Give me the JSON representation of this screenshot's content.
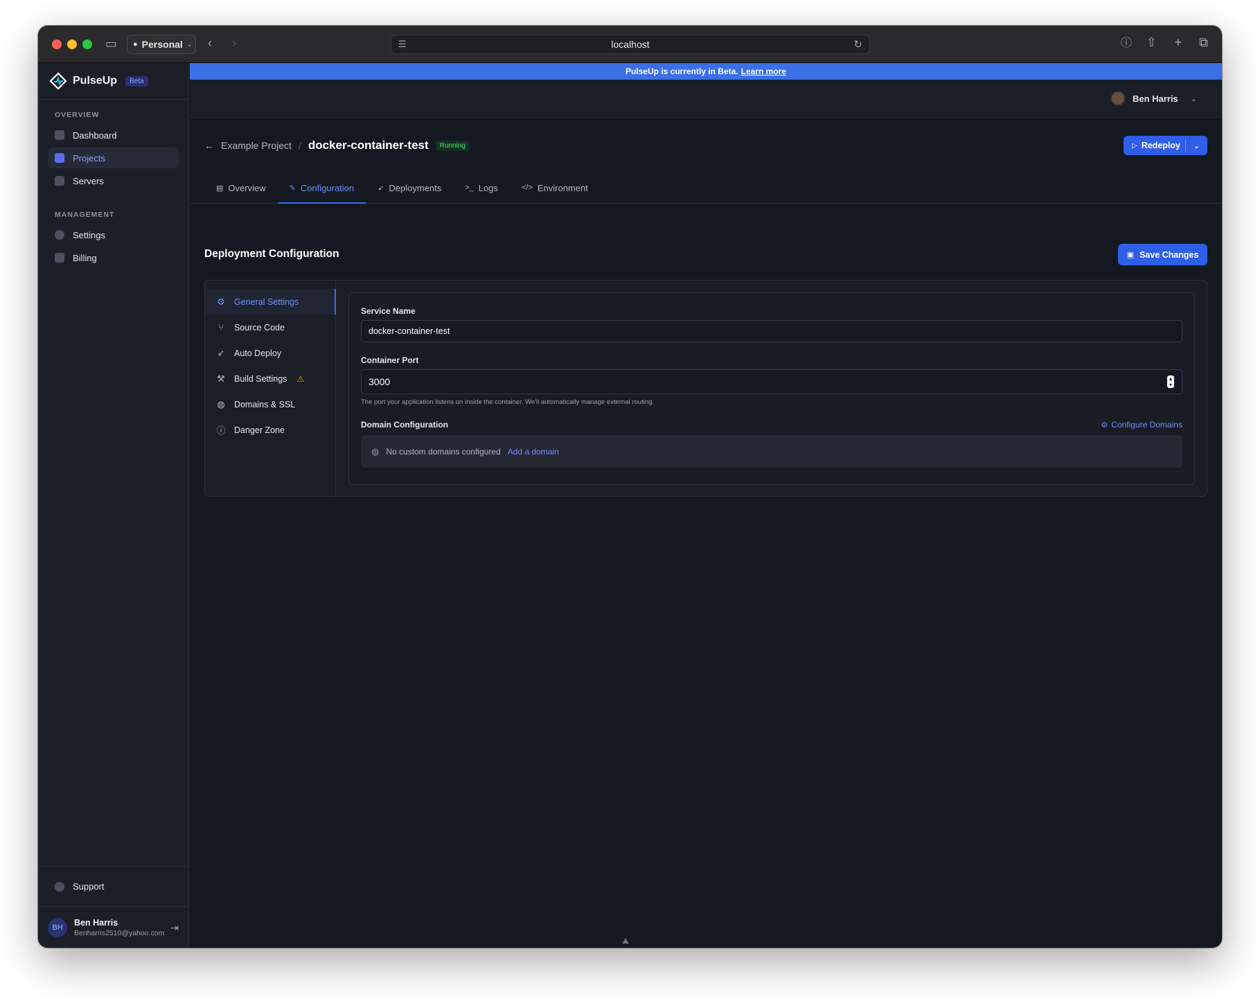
{
  "browser": {
    "profile_label": "Personal",
    "url": "localhost"
  },
  "sidebar": {
    "brand_name": "PulseUp",
    "brand_badge": "Beta",
    "sections": [
      {
        "label": "OVERVIEW",
        "items": [
          {
            "label": "Dashboard",
            "icon": "dashboard-icon",
            "active": false
          },
          {
            "label": "Projects",
            "icon": "folder-icon",
            "active": true
          },
          {
            "label": "Servers",
            "icon": "server-icon",
            "active": false
          }
        ]
      },
      {
        "label": "MANAGEMENT",
        "items": [
          {
            "label": "Settings",
            "icon": "gear-icon",
            "active": false
          },
          {
            "label": "Billing",
            "icon": "credit-card-icon",
            "active": false
          }
        ]
      }
    ],
    "support_label": "Support",
    "user": {
      "initials": "BH",
      "name": "Ben Harris",
      "email": "Benharris2510@yahoo.com"
    }
  },
  "banner": {
    "text": "PulseUp is currently in Beta.",
    "link_label": "Learn more"
  },
  "topbar": {
    "user_name": "Ben Harris"
  },
  "header": {
    "back_label": "Example Project",
    "separator": "/",
    "project_name": "docker-container-test",
    "status": "Running",
    "redeploy_label": "Redeploy",
    "tabs": [
      {
        "label": "Overview",
        "icon": "layout-icon",
        "active": false
      },
      {
        "label": "Configuration",
        "icon": "wrench-icon",
        "active": true
      },
      {
        "label": "Deployments",
        "icon": "rocket-icon",
        "active": false
      },
      {
        "label": "Logs",
        "icon": "terminal-icon",
        "active": false
      },
      {
        "label": "Environment",
        "icon": "code-icon",
        "active": false
      }
    ]
  },
  "content": {
    "title": "Deployment Configuration",
    "save_label": "Save Changes",
    "config_nav": [
      {
        "label": "General Settings",
        "icon": "gear-icon",
        "active": true,
        "warning": false
      },
      {
        "label": "Source Code",
        "icon": "git-branch-icon",
        "active": false,
        "warning": false
      },
      {
        "label": "Auto Deploy",
        "icon": "rocket-icon",
        "active": false,
        "warning": false
      },
      {
        "label": "Build Settings",
        "icon": "hammer-icon",
        "active": false,
        "warning": true
      },
      {
        "label": "Domains & SSL",
        "icon": "globe-icon",
        "active": false,
        "warning": false
      },
      {
        "label": "Danger Zone",
        "icon": "alert-circle-icon",
        "active": false,
        "warning": false
      }
    ],
    "service_name_label": "Service Name",
    "service_name_value": "docker-container-test",
    "container_port_label": "Container Port",
    "container_port_value": "3000",
    "container_port_hint": "The port your application listens on inside the container. We'll automatically manage external routing.",
    "domain_label": "Domain Configuration",
    "configure_domains_label": "Configure Domains",
    "no_domains_text": "No custom domains configured",
    "add_domain_label": "Add a domain"
  },
  "colors": {
    "accent": "#2f5ee8",
    "banner": "#3b6fe6",
    "status_running": "#4ade80",
    "warning": "#f59e0b"
  }
}
